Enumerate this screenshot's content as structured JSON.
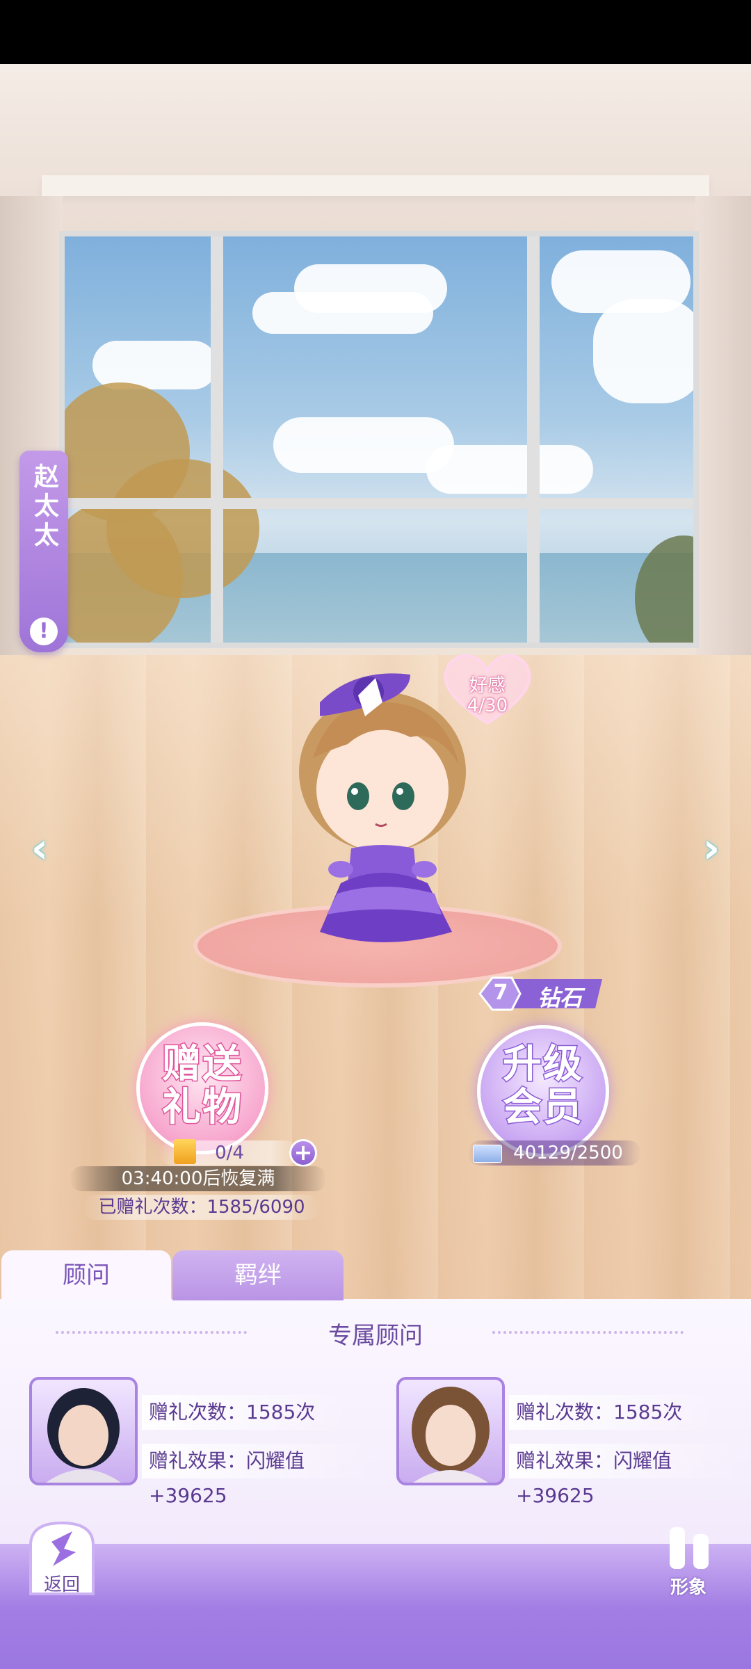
{
  "character": {
    "name": "赵太太",
    "affection_label": "好感",
    "affection_value": "4/30"
  },
  "gift": {
    "button_label_line1": "赠送",
    "button_label_line2": "礼物",
    "count": "0/4",
    "recover_text": "03:40:00后恢复满",
    "gifted_text": "已赠礼次数：1585/6090"
  },
  "vip": {
    "level": "7",
    "tier": "钻石",
    "button_label_line1": "升级",
    "button_label_line2": "会员",
    "exp": "40129/2500"
  },
  "tabs": [
    {
      "label": "顾问"
    },
    {
      "label": "羁绊"
    }
  ],
  "section_title": "专属顾问",
  "advisors": [
    {
      "gift_count": "赠礼次数：1585次",
      "gift_effect": "赠礼效果：闪耀值+39625"
    },
    {
      "gift_count": "赠礼次数：1585次",
      "gift_effect": "赠礼效果：闪耀值+39625"
    }
  ],
  "nav": {
    "back_label": "返回",
    "style_label": "形象"
  },
  "colors": {
    "accent_purple": "#9e74d8",
    "pink": "#ee86ba"
  }
}
